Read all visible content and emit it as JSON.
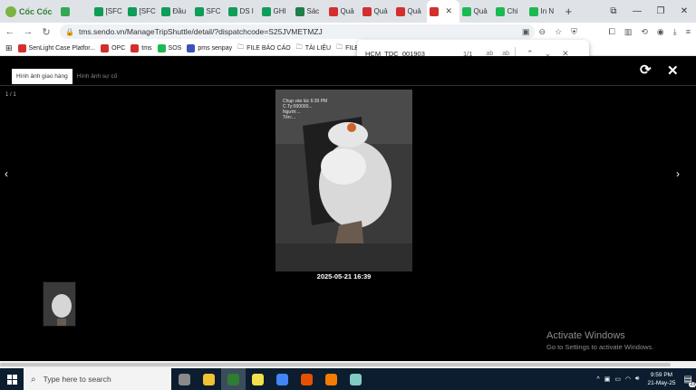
{
  "browser": {
    "brand": "Cốc Cốc",
    "tabs": [
      {
        "label": "",
        "color": "#34a853"
      },
      {
        "label": "[SFC",
        "color": "#0f9d58"
      },
      {
        "label": "[SFC",
        "color": "#0f9d58"
      },
      {
        "label": "Đầu",
        "color": "#0f9d58"
      },
      {
        "label": "SFC",
        "color": "#0f9d58"
      },
      {
        "label": "DS l",
        "color": "#0f9d58"
      },
      {
        "label": "GHI",
        "color": "#0f9d58"
      },
      {
        "label": "Sác",
        "color": "#1e7e45"
      },
      {
        "label": "Quả",
        "color": "#d32f2f"
      },
      {
        "label": "Quả",
        "color": "#d32f2f"
      },
      {
        "label": "Quả",
        "color": "#d32f2f"
      },
      {
        "label": "",
        "color": "#d32f2f",
        "active": true
      },
      {
        "label": "Quả",
        "color": "#1db954"
      },
      {
        "label": "Chi",
        "color": "#1db954"
      },
      {
        "label": "In N",
        "color": "#1db954"
      }
    ],
    "url": "tms.sendo.vn/ManageTripShuttle/detail/?dispatchcode=S25JVMETMZJ",
    "bookmarks": [
      {
        "label": "SenLight Case Platfor...",
        "color": "#d32f2f"
      },
      {
        "label": "OPC",
        "color": "#d32f2f"
      },
      {
        "label": "tms",
        "color": "#d32f2f"
      },
      {
        "label": "SOS",
        "color": "#1db954"
      },
      {
        "label": "pms senpay",
        "color": "#3f51b5"
      },
      {
        "label": "FILE BÁO CÁO",
        "color": "folder"
      },
      {
        "label": "TÀI LIỆU",
        "color": "folder"
      },
      {
        "label": "FILE C",
        "color": "folder"
      }
    ]
  },
  "findbar": {
    "query": "HCM_TDC_001903",
    "count": "1/1",
    "opt1": "ab",
    "opt2": "a͟b"
  },
  "viewer": {
    "tabs": [
      "Hình ảnh giao hàng",
      "Hình ảnh sự cố"
    ],
    "counter": "1 / 1",
    "photo_stamp": [
      "Chụp vào lúc 6:39 PM",
      "C.Ty:000000...",
      "Người:...",
      "Tên:..."
    ],
    "photo_datetime": "2025-05-21 16:39"
  },
  "watermark": {
    "line1": "Activate Windows",
    "line2": "Go to Settings to activate Windows."
  },
  "taskbar": {
    "search_placeholder": "Type here to search",
    "time": "9:59 PM",
    "date": "21-May-25",
    "notifications": "23",
    "apps": [
      "#8a8a8a",
      "#f1c232",
      "#2e7d32",
      "#f4e04d",
      "#4285f4",
      "#e65100",
      "#f57c00",
      "#80cbc4"
    ]
  }
}
